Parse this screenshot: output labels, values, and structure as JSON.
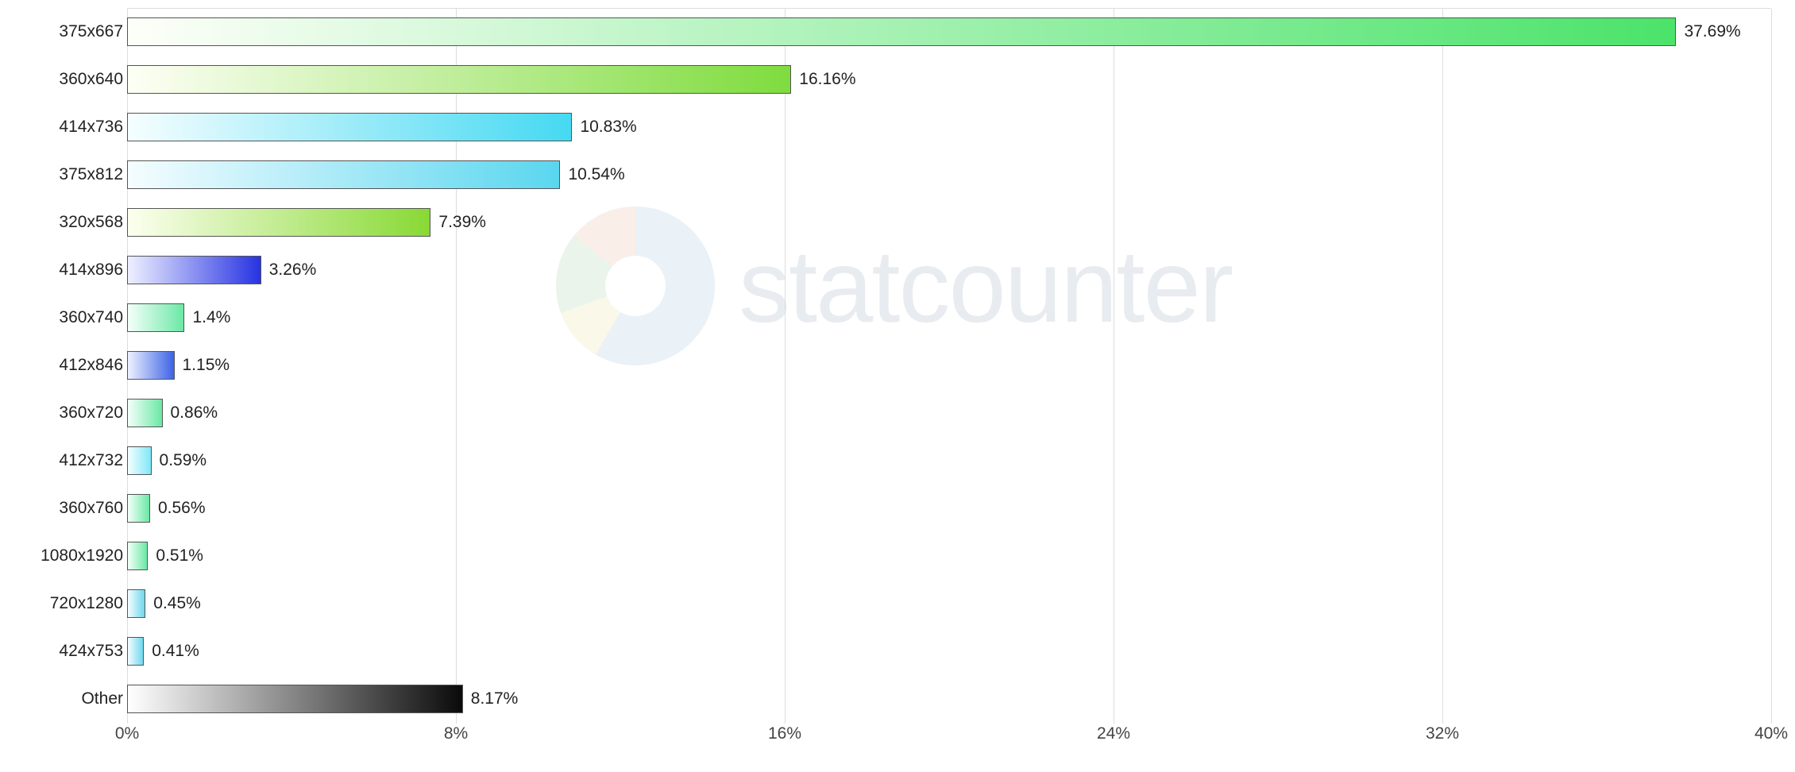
{
  "watermark": "statcounter",
  "chart_data": {
    "type": "bar",
    "orientation": "horizontal",
    "xlabel": "",
    "ylabel": "",
    "xlim": [
      0,
      40
    ],
    "x_ticks": [
      0,
      8,
      16,
      24,
      32,
      40
    ],
    "x_tick_labels": [
      "0%",
      "8%",
      "16%",
      "24%",
      "32%",
      "40%"
    ],
    "categories": [
      "375x667",
      "360x640",
      "414x736",
      "375x812",
      "320x568",
      "414x896",
      "360x740",
      "412x846",
      "360x720",
      "412x732",
      "360x760",
      "1080x1920",
      "720x1280",
      "424x753",
      "Other"
    ],
    "values": [
      37.69,
      16.16,
      10.83,
      10.54,
      7.39,
      3.26,
      1.4,
      1.15,
      0.86,
      0.59,
      0.56,
      0.51,
      0.45,
      0.41,
      8.17
    ],
    "value_labels": [
      "37.69%",
      "16.16%",
      "10.83%",
      "10.54%",
      "7.39%",
      "3.26%",
      "1.4%",
      "1.15%",
      "0.86%",
      "0.59%",
      "0.56%",
      "0.51%",
      "0.45%",
      "0.41%",
      "8.17%"
    ],
    "colors": [
      "green",
      "lime",
      "cyan",
      "skyblue",
      "lime2",
      "royalblue",
      "mint",
      "blue",
      "mint2",
      "paleblue",
      "mint3",
      "mint4",
      "skyblue2",
      "skyblue3",
      "gray"
    ]
  }
}
